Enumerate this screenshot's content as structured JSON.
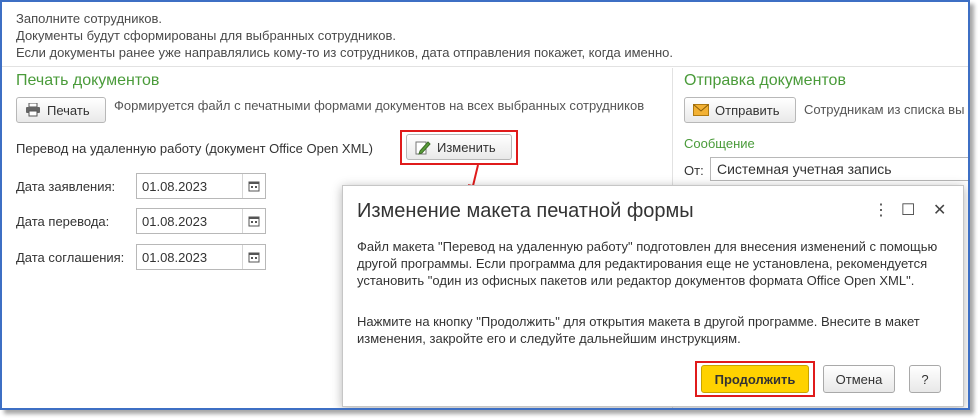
{
  "info_lines": [
    "Заполните сотрудников.",
    "Документы будут сформированы для выбранных сотрудников.",
    "Если документы ранее уже направлялись кому-то из сотрудников, дата отправления покажет, когда именно."
  ],
  "print_section": {
    "title": "Печать документов",
    "print_button": "Печать",
    "hint": "Формируется файл с печатными формами документов на всех выбранных сотрудников",
    "document_label": "Перевод на удаленную работу (документ Office Open XML)",
    "change_button": "Изменить",
    "dates": [
      {
        "label": "Дата заявления:",
        "value": "01.08.2023"
      },
      {
        "label": "Дата перевода:",
        "value": "01.08.2023"
      },
      {
        "label": "Дата соглашения:",
        "value": "01.08.2023"
      }
    ]
  },
  "send_section": {
    "title": "Отправка документов",
    "send_button": "Отправить",
    "hint": "Сотрудникам из списка вы",
    "message_label": "Сообщение",
    "from_label": "От:",
    "from_value": "Системная учетная запись"
  },
  "dialog": {
    "title": "Изменение макета печатной формы",
    "para1": "Файл макета \"Перевод на удаленную работу\" подготовлен для внесения изменений с помощью другой программы. Если программа для редактирования еще не установлена, рекомендуется установить \"один из офисных пакетов или редактор документов формата Office Open XML\".",
    "para2": "Нажмите на кнопку \"Продолжить\" для открытия макета в другой программе. Внесите в макет изменения, закройте его и следуйте дальнейшим инструкциям.",
    "continue_button": "Продолжить",
    "cancel_button": "Отмена",
    "help_button": "?",
    "menu_glyph": "⋮",
    "maximize_glyph": "☐",
    "close_glyph": "✕"
  },
  "colors": {
    "section_title": "#4a9b3a",
    "highlight": "#e01b1b",
    "primary_button": "#ffd200",
    "frame_border": "#3d6fc4"
  }
}
